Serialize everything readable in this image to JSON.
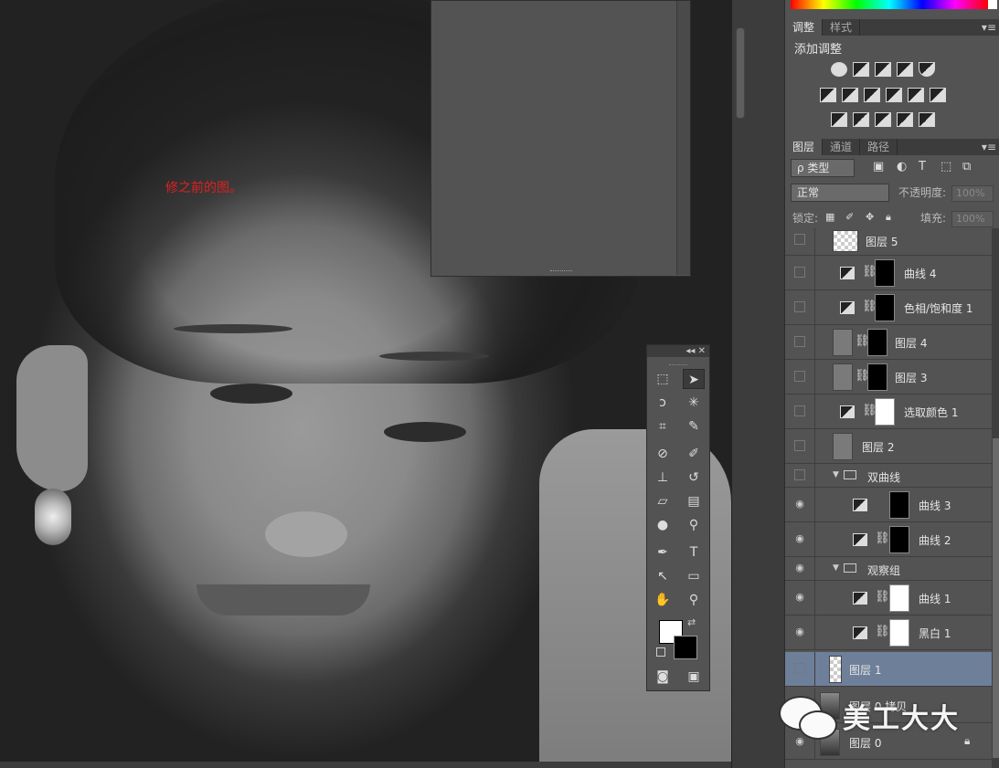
{
  "canvas": {
    "note": "修之前的图。"
  },
  "adjustments_panel": {
    "tabs": [
      "调整",
      "样式"
    ],
    "title": "添加调整"
  },
  "layers_panel": {
    "tabs": [
      "图层",
      "通道",
      "路径"
    ],
    "filter_kind": "ρ 类型",
    "blend_mode": "正常",
    "opacity_label": "不透明度:",
    "opacity_value": "100%",
    "lock_label": "锁定:",
    "fill_label": "填充:",
    "fill_value": "100%",
    "layers": [
      {
        "name": "图层 5",
        "visible": false
      },
      {
        "name": "曲线 4",
        "visible": false
      },
      {
        "name": "色相/饱和度 1",
        "visible": false
      },
      {
        "name": "图层 4",
        "visible": false
      },
      {
        "name": "图层 3",
        "visible": false
      },
      {
        "name": "选取颜色 1",
        "visible": false
      },
      {
        "name": "图层 2",
        "visible": false
      },
      {
        "name": "双曲线",
        "visible": false,
        "group": true
      },
      {
        "name": "曲线 3",
        "visible": true
      },
      {
        "name": "曲线 2",
        "visible": true
      },
      {
        "name": "观察组",
        "visible": true,
        "group": true
      },
      {
        "name": "曲线 1",
        "visible": true
      },
      {
        "name": "黑白 1",
        "visible": true
      },
      {
        "name": "图层 1",
        "visible": false,
        "selected": true
      },
      {
        "name": "图层 0 拷贝",
        "visible": true
      },
      {
        "name": "图层 0",
        "visible": true
      }
    ]
  },
  "watermark": {
    "text": "美工大大"
  },
  "icons": {
    "eye": "eye-icon",
    "link": "chain-link-icon",
    "lock": "lock-icon",
    "folder": "folder-icon"
  }
}
